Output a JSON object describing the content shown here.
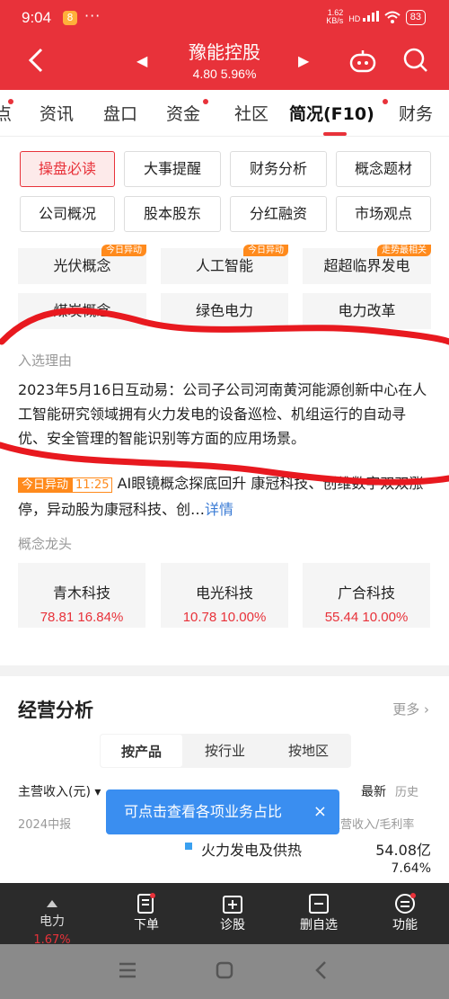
{
  "status_bar": {
    "time": "9:04",
    "app_icon": "8",
    "dots": "···",
    "net_speed_value": "1.62",
    "net_speed_unit": "KB/s",
    "network": "HD",
    "battery": "83"
  },
  "header": {
    "stock_name": "豫能控股",
    "price_line": "4.80 5.96%"
  },
  "tabs": [
    "点",
    "资讯",
    "盘口",
    "资金",
    "社区",
    "简况(F10)",
    "财务"
  ],
  "action_buttons": [
    "操盘必读",
    "大事提醒",
    "财务分析",
    "概念题材",
    "公司概况",
    "股本股东",
    "分红融资",
    "市场观点"
  ],
  "concepts": [
    {
      "label": "光伏概念",
      "tag": "今日异动"
    },
    {
      "label": "人工智能",
      "tag": "今日异动"
    },
    {
      "label": "超超临界发电",
      "tag": "走势最相关"
    },
    {
      "label": "煤炭概念",
      "tag": ""
    },
    {
      "label": "绿色电力",
      "tag": ""
    },
    {
      "label": "电力改革",
      "tag": ""
    }
  ],
  "reason": {
    "label": "入选理由",
    "text": "2023年5月16日互动易：公司子公司河南黄河能源创新中心在人工智能研究领域拥有火力发电的设备巡检、机组运行的自动寻优、安全管理的智能识别等方面的应用场景。"
  },
  "news": {
    "badge": "今日异动",
    "time": "11:25",
    "text": "AI眼镜概念探底回升 康冠科技、创维数字双双涨停，异动股为康冠科技、创…",
    "link": "详情"
  },
  "leaders": {
    "label": "概念龙头",
    "items": [
      {
        "name": "青木科技",
        "value": "78.81 16.84%"
      },
      {
        "name": "电光科技",
        "value": "10.78 10.00%"
      },
      {
        "name": "广合科技",
        "value": "55.44 10.00%"
      }
    ]
  },
  "business": {
    "title": "经营分析",
    "more": "更多 ›",
    "segments": [
      "按产品",
      "按行业",
      "按地区"
    ],
    "revenue_label": "主营收入(元) ▾",
    "latest": "最新",
    "history": "历史",
    "period": "2024中报",
    "col_header": "主营收入/毛利率",
    "item_name": "火力发电及供热",
    "item_value": "54.08亿",
    "item_margin": "7.64%"
  },
  "tooltip": {
    "text": "可点击查看各项业务占比",
    "close": "×"
  },
  "bottom_bar": [
    {
      "label": "电力",
      "sub": "1.67%"
    },
    {
      "label": "下单",
      "sub": ""
    },
    {
      "label": "诊股",
      "sub": ""
    },
    {
      "label": "删自选",
      "sub": ""
    },
    {
      "label": "功能",
      "sub": ""
    }
  ],
  "colors": {
    "brand_red": "#e8323a",
    "orange_tag": "#ff8a1c",
    "tooltip_blue": "#3a8ef0",
    "link_blue": "#3a7bd5"
  }
}
